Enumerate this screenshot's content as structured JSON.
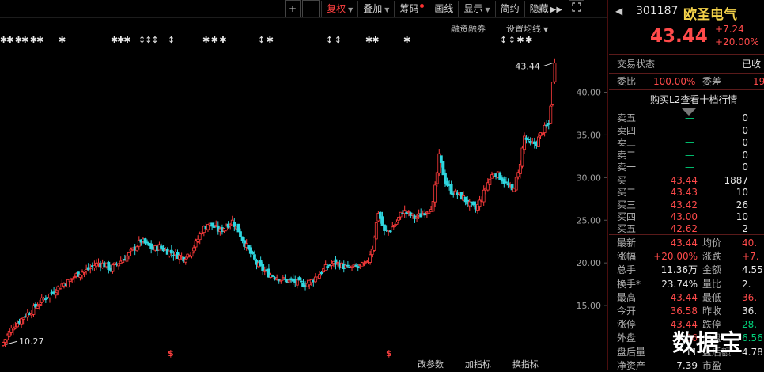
{
  "toolbar": {
    "zoom_in": "+",
    "zoom_out": "—",
    "fuquan": "复权",
    "diejia": "叠加",
    "choumа": "筹码",
    "huaxian": "画线",
    "xianshi": "显示",
    "jianyue": "简约",
    "yincang": "隐藏"
  },
  "chart_links": {
    "margin_trading": "融资融券",
    "set_ma": "设置均线"
  },
  "chart_data": {
    "type": "candlestick",
    "high_label": "43.44",
    "low_label": "10.27",
    "y_ticks": [
      "40.00",
      "35.00",
      "30.00",
      "25.00",
      "20.00",
      "15.00"
    ],
    "ylim": [
      10,
      44.5
    ],
    "bottom_labels": [
      "改参数",
      "加指标",
      "换指标"
    ],
    "closes": [
      10.3,
      11.5,
      12.6,
      13.2,
      13.9,
      14.4,
      15.1,
      15.8,
      16.3,
      16.9,
      17.5,
      17.8,
      18.4,
      18.9,
      19.1,
      19.6,
      20.0,
      19.8,
      19.3,
      19.9,
      20.4,
      21.0,
      21.8,
      22.6,
      22.1,
      21.6,
      21.9,
      21.5,
      21.2,
      20.9,
      20.6,
      21.2,
      22.3,
      23.8,
      24.6,
      24.2,
      23.7,
      24.4,
      24.9,
      23.8,
      22.3,
      21.1,
      19.9,
      19.2,
      18.7,
      18.5,
      18.1,
      17.9,
      17.8,
      17.6,
      17.5,
      17.9,
      18.5,
      19.2,
      19.8,
      20.0,
      19.7,
      19.4,
      19.5,
      19.6,
      19.8,
      21.8,
      26.0,
      23.6,
      23.9,
      24.8,
      26.1,
      25.7,
      25.3,
      25.6,
      26.2,
      26.9,
      32.4,
      29.6,
      28.4,
      28.0,
      27.6,
      26.8,
      26.3,
      27.6,
      29.4,
      30.7,
      30.1,
      29.3,
      28.4,
      30.4,
      34.8,
      33.8,
      34.1,
      35.5,
      36.2,
      43.44
    ]
  },
  "quote": {
    "code": "301187",
    "name": "欧圣电气",
    "price": "43.44",
    "change": "+7.24",
    "change_pct": "+20.00%"
  },
  "status": {
    "label": "交易状态",
    "value": "已收"
  },
  "ratio": {
    "label1": "委比",
    "value1": "100.00%",
    "label2": "委差",
    "value2": "19"
  },
  "l2_link": "购买L2查看十档行情",
  "sell_levels": [
    {
      "label": "卖五",
      "price": "—",
      "vol": "0"
    },
    {
      "label": "卖四",
      "price": "—",
      "vol": "0"
    },
    {
      "label": "卖三",
      "price": "—",
      "vol": "0"
    },
    {
      "label": "卖二",
      "price": "—",
      "vol": "0"
    },
    {
      "label": "卖一",
      "price": "—",
      "vol": "0"
    }
  ],
  "buy_levels": [
    {
      "label": "买一",
      "price": "43.44",
      "vol": "1887"
    },
    {
      "label": "买二",
      "price": "43.43",
      "vol": "10"
    },
    {
      "label": "买三",
      "price": "43.42",
      "vol": "26"
    },
    {
      "label": "买四",
      "price": "43.00",
      "vol": "10"
    },
    {
      "label": "买五",
      "price": "42.62",
      "vol": "2"
    }
  ],
  "stats": [
    {
      "l1": "最新",
      "v1": "43.44",
      "c1": "red",
      "l2": "均价",
      "v2": "40.",
      "c2": "red"
    },
    {
      "l1": "涨幅",
      "v1": "+20.00%",
      "c1": "red",
      "l2": "涨跌",
      "v2": "+7.",
      "c2": "red"
    },
    {
      "l1": "总手",
      "v1": "11.36万",
      "c1": "white",
      "l2": "金额",
      "v2": "4.55",
      "c2": "white"
    },
    {
      "l1": "换手*",
      "v1": "23.74%",
      "c1": "white",
      "l2": "量比",
      "v2": "2.",
      "c2": "white"
    },
    {
      "l1": "最高",
      "v1": "43.44",
      "c1": "red",
      "l2": "最低",
      "v2": "36.",
      "c2": "red"
    },
    {
      "l1": "今开",
      "v1": "36.58",
      "c1": "red",
      "l2": "昨收",
      "v2": "36.",
      "c2": "white"
    },
    {
      "l1": "涨停",
      "v1": "43.44",
      "c1": "red",
      "l2": "跌停",
      "v2": "28.",
      "c2": "green"
    },
    {
      "l1": "外盘",
      "v1": "4.56",
      "c1": "red",
      "l2": "内盘",
      "v2": "6.56",
      "c2": "green"
    },
    {
      "l1": "盘后量",
      "v1": "11",
      "c1": "white",
      "l2": "盘后额",
      "v2": "4.78",
      "c2": "white"
    },
    {
      "l1": "净资产",
      "v1": "7.39",
      "c1": "white",
      "l2": "市盈",
      "v2": "",
      "c2": "white"
    }
  ],
  "watermark": "数据宝"
}
